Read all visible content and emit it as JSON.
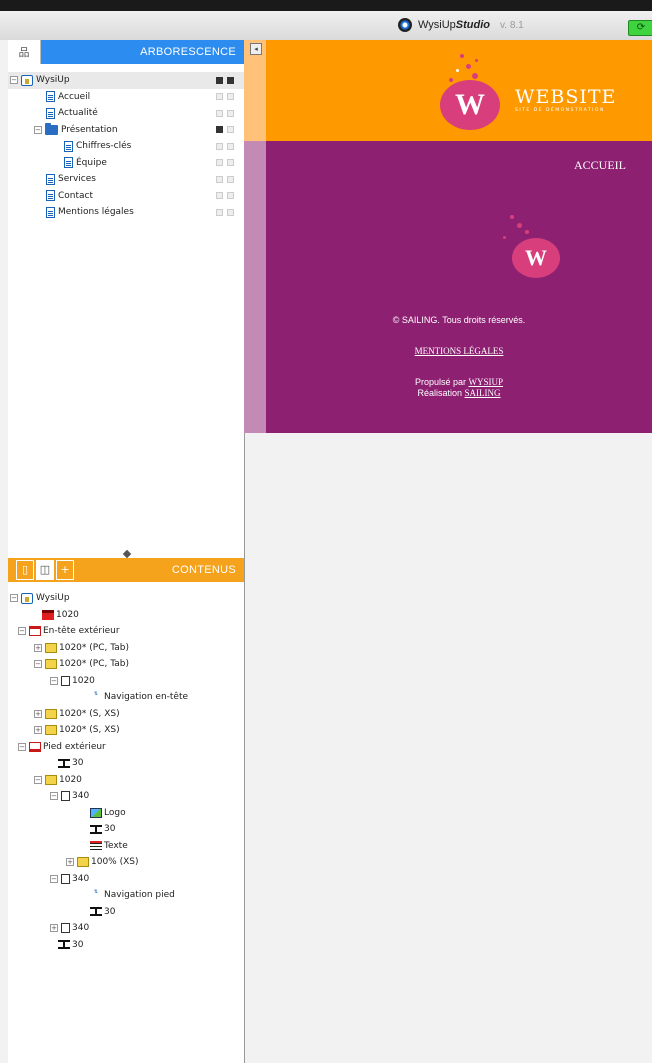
{
  "app": {
    "brand": "WysiUp",
    "brand_studio": "Studio",
    "version": "v. 8.1"
  },
  "tree_panel": {
    "title": "ARBORESCENCE",
    "root": "WysiUp",
    "items": [
      {
        "label": "Accueil",
        "level": 1,
        "type": "page"
      },
      {
        "label": "Actualité",
        "level": 1,
        "type": "page"
      },
      {
        "label": "Présentation",
        "level": 1,
        "type": "folder"
      },
      {
        "label": "Chiffres-clés",
        "level": 2,
        "type": "page"
      },
      {
        "label": "Équipe",
        "level": 2,
        "type": "page"
      },
      {
        "label": "Services",
        "level": 1,
        "type": "page"
      },
      {
        "label": "Contact",
        "level": 1,
        "type": "page"
      },
      {
        "label": "Mentions légales",
        "level": 1,
        "type": "page"
      }
    ]
  },
  "content_panel": {
    "title": "CONTENUS",
    "root": "WysiUp",
    "items": [
      {
        "label": "1020",
        "level": 1,
        "icon": "red-block-icon"
      },
      {
        "label": "En-tête extérieur",
        "level": 1,
        "icon": "section-icon",
        "exp": "−"
      },
      {
        "label": "1020* (PC, Tab)",
        "level": 2,
        "icon": "grid-icon",
        "exp": "+"
      },
      {
        "label": "1020* (PC, Tab)",
        "level": 2,
        "icon": "grid-icon",
        "exp": "−"
      },
      {
        "label": "1020",
        "level": 3,
        "icon": "column-icon",
        "exp": "−"
      },
      {
        "label": "Navigation en-tête",
        "level": 4,
        "icon": "navigation-icon"
      },
      {
        "label": "1020* (S, XS)",
        "level": 2,
        "icon": "grid-icon",
        "exp": "+"
      },
      {
        "label": "1020* (S, XS)",
        "level": 2,
        "icon": "grid-icon",
        "exp": "+"
      },
      {
        "label": "Pied extérieur",
        "level": 1,
        "icon": "footer-icon",
        "exp": "−"
      },
      {
        "label": "30",
        "level": 2,
        "icon": "spacer-icon"
      },
      {
        "label": "1020",
        "level": 2,
        "icon": "grid-icon",
        "exp": "−"
      },
      {
        "label": "340",
        "level": 3,
        "icon": "column-icon",
        "exp": "−"
      },
      {
        "label": "Logo",
        "level": 4,
        "icon": "image-icon"
      },
      {
        "label": "30",
        "level": 4,
        "icon": "spacer-icon"
      },
      {
        "label": "Texte",
        "level": 4,
        "icon": "text-icon"
      },
      {
        "label": "100% (XS)",
        "level": 4,
        "icon": "grid-icon",
        "exp": "+"
      },
      {
        "label": "340",
        "level": 3,
        "icon": "column-icon",
        "exp": "−"
      },
      {
        "label": "Navigation pied",
        "level": 4,
        "icon": "navigation-icon"
      },
      {
        "label": "30",
        "level": 4,
        "icon": "spacer-icon"
      },
      {
        "label": "340",
        "level": 3,
        "icon": "column-icon",
        "exp": "+"
      },
      {
        "label": "30",
        "level": 2,
        "icon": "spacer-icon"
      }
    ]
  },
  "preview": {
    "logo_letter": "W",
    "website": "WEBSITE",
    "website_sub": "SITE DE DÉMONSTRATION",
    "page_title": "ACCUEIL",
    "copyright": "© SAILING. Tous droits réservés.",
    "legal_link": "MENTIONS LÉGALES",
    "powered_prefix": "Propulsé par",
    "powered_link": "WYSIUP",
    "made_prefix": "Réalisation",
    "made_link": "SAILING"
  },
  "colors": {
    "blue": "#2d8cf0",
    "orange": "#f5a21c",
    "site_orange": "#ff9900",
    "purple": "#8d2071",
    "pink": "#d93e7c"
  }
}
